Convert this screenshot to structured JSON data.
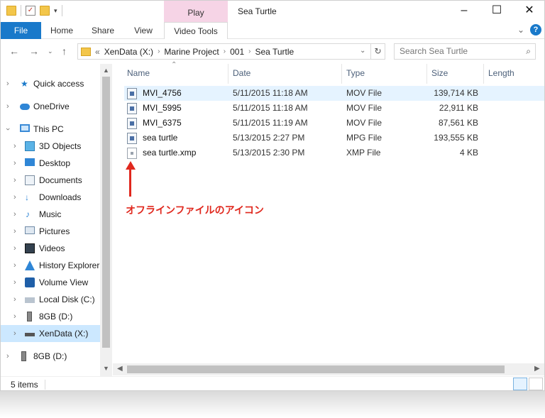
{
  "titlebar": {
    "context_tab": "Play",
    "title": "Sea Turtle"
  },
  "window_controls": {
    "minimize": "–",
    "maximize": "☐",
    "close": "✕"
  },
  "ribbon": {
    "tabs": [
      {
        "label": "File"
      },
      {
        "label": "Home"
      },
      {
        "label": "Share"
      },
      {
        "label": "View"
      },
      {
        "label": "Video Tools"
      }
    ],
    "help": "?"
  },
  "address": {
    "crumbs": [
      "«",
      "XenData (X:)",
      "Marine Project",
      "001",
      "Sea Turtle"
    ],
    "search_placeholder": "Search Sea Turtle"
  },
  "nav": {
    "items": [
      {
        "label": "Quick access",
        "icon": "star-icon"
      },
      {
        "label": "OneDrive",
        "icon": "cloud-icon"
      },
      {
        "label": "This PC",
        "icon": "computer-icon"
      },
      {
        "label": "3D Objects",
        "icon": "cube-icon"
      },
      {
        "label": "Desktop",
        "icon": "desktop-icon"
      },
      {
        "label": "Documents",
        "icon": "document-icon"
      },
      {
        "label": "Downloads",
        "icon": "download-icon"
      },
      {
        "label": "Music",
        "icon": "music-icon"
      },
      {
        "label": "Pictures",
        "icon": "picture-icon"
      },
      {
        "label": "Videos",
        "icon": "video-icon"
      },
      {
        "label": "History Explorer",
        "icon": "history-icon"
      },
      {
        "label": "Volume View",
        "icon": "volume-icon"
      },
      {
        "label": "Local Disk (C:)",
        "icon": "disk-icon"
      },
      {
        "label": "8GB (D:)",
        "icon": "usb-icon"
      },
      {
        "label": "XenData (X:)",
        "icon": "drive-icon"
      },
      {
        "label": "8GB (D:)",
        "icon": "usb-icon"
      }
    ]
  },
  "columns": {
    "name": "Name",
    "date": "Date",
    "type": "Type",
    "size": "Size",
    "length": "Length"
  },
  "files": [
    {
      "name": "MVI_4756",
      "date": "5/11/2015 11:18 AM",
      "type": "MOV File",
      "size": "139,714 KB"
    },
    {
      "name": "MVI_5995",
      "date": "5/11/2015 11:18 AM",
      "type": "MOV File",
      "size": "22,911 KB"
    },
    {
      "name": "MVI_6375",
      "date": "5/11/2015 11:19 AM",
      "type": "MOV File",
      "size": "87,561 KB"
    },
    {
      "name": "sea turtle",
      "date": "5/13/2015 2:27 PM",
      "type": "MPG File",
      "size": "193,555 KB"
    },
    {
      "name": "sea turtle.xmp",
      "date": "5/13/2015 2:30 PM",
      "type": "XMP File",
      "size": "4 KB"
    }
  ],
  "annotation": "オフラインファイルのアイコン",
  "status": {
    "count": "5 items"
  },
  "colors": {
    "accent": "#1979ca",
    "annotation": "#e0281e",
    "selection": "#cce8ff"
  }
}
